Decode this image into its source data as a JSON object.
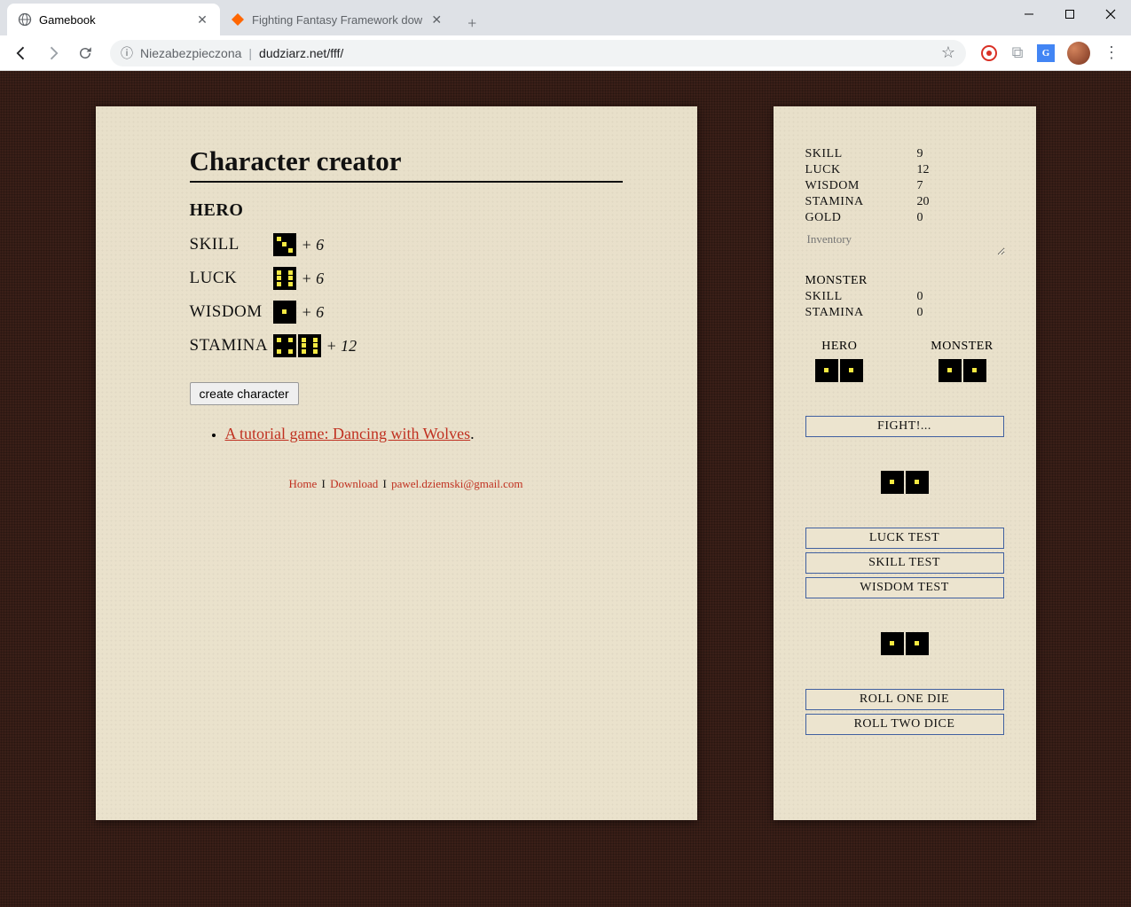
{
  "window": {
    "tabs": [
      {
        "title": "Gamebook",
        "active": true
      },
      {
        "title": "Fighting Fantasy Framework dow",
        "active": false
      }
    ],
    "url_security": "Niezabezpieczona",
    "url": "dudziarz.net/fff/"
  },
  "main": {
    "title": "Character creator",
    "hero_heading": "HERO",
    "stats": {
      "skill": {
        "label": "SKILL",
        "bonus": "+ 6"
      },
      "luck": {
        "label": "LUCK",
        "bonus": "+ 6"
      },
      "wisdom": {
        "label": "WISDOM",
        "bonus": "+ 6"
      },
      "stamina": {
        "label": "STAMINA",
        "bonus": "+ 12"
      }
    },
    "create_button": "create character",
    "tutorial_link": "A tutorial game: Dancing with Wolves",
    "period": ".",
    "footer": {
      "home": "Home",
      "download": "Download",
      "email": "pawel.dziemski@gmail.com",
      "sep": "I"
    }
  },
  "side": {
    "stats": {
      "skill": {
        "label": "SKILL",
        "value": "9"
      },
      "luck": {
        "label": "LUCK",
        "value": "12"
      },
      "wisdom": {
        "label": "WISDOM",
        "value": "7"
      },
      "stamina": {
        "label": "STAMINA",
        "value": "20"
      },
      "gold": {
        "label": "GOLD",
        "value": "0"
      }
    },
    "inventory_label": "Inventory",
    "monster_heading": "MONSTER",
    "monster": {
      "skill": {
        "label": "SKILL",
        "value": "0"
      },
      "stamina": {
        "label": "STAMINA",
        "value": "0"
      }
    },
    "fight": {
      "hero_label": "HERO",
      "monster_label": "MONSTER",
      "fight_button": "FIGHT!..."
    },
    "tests": {
      "luck": "LUCK TEST",
      "skill": "SKILL TEST",
      "wisdom": "WISDOM TEST"
    },
    "rolls": {
      "one": "ROLL ONE DIE",
      "two": "ROLL TWO DICE"
    }
  }
}
